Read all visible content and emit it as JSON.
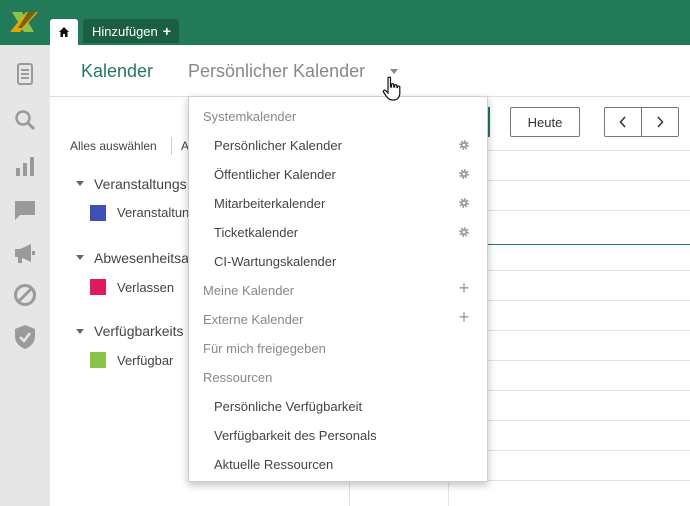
{
  "topbar": {
    "home_tab": "home-icon",
    "add_tab_label": "Hinzufügen",
    "add_tab_plus": "+"
  },
  "sidebar": {
    "icons": [
      "document-icon",
      "search-icon",
      "bar-chart-icon",
      "chat-icon",
      "megaphone-icon",
      "block-icon",
      "shield-check-icon"
    ]
  },
  "header": {
    "title": "Kalender",
    "calendar_selector": "Persönlicher Kalender"
  },
  "filters": {
    "select_all": "Alles auswählen",
    "select_all_other": "A",
    "groups": [
      {
        "label": "Veranstaltungs",
        "item_label": "Veranstaltun",
        "color": "#3f4fb5"
      },
      {
        "label": "Abwesenheitsa",
        "item_label": "Verlassen",
        "color": "#e0195f"
      },
      {
        "label": "Verfügbarkeits",
        "item_label": "Verfügbar",
        "color": "#8bc34a"
      }
    ]
  },
  "toolbar": {
    "today": "Heute",
    "prev": "‹",
    "next": "›"
  },
  "dropdown": {
    "system_header": "Systemkalender",
    "system_items": [
      "Persönlicher Kalender",
      "Öffentlicher Kalender",
      "Mitarbeiterkalender",
      "Ticketkalender",
      "CI-Wartungskalender"
    ],
    "my_calendars": "Meine Kalender",
    "external_calendars": "Externe Kalender",
    "shared_with_me": "Für mich freigegeben",
    "resources_header": "Ressourcen",
    "resource_items": [
      "Persönliche Verfügbarkeit",
      "Verfügbarkeit des Personals",
      "Aktuelle Ressourcen"
    ],
    "add_symbol": "+"
  },
  "colors": {
    "brand_green": "#237a58",
    "header_dark_green": "#1a5f43"
  }
}
